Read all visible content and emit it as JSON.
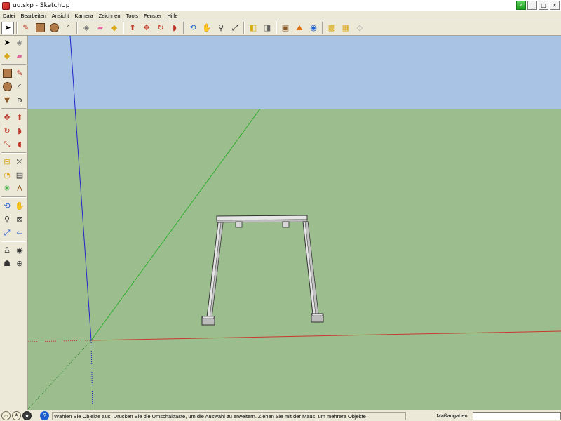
{
  "window": {
    "title": "uu.skp - SketchUp",
    "controls": [
      "_",
      "□",
      "✕"
    ]
  },
  "menu": {
    "items": [
      "Datei",
      "Bearbeiten",
      "Ansicht",
      "Kamera",
      "Zeichnen",
      "Tools",
      "Fenster",
      "Hilfe"
    ]
  },
  "top_toolbar": {
    "icons": [
      "select-icon",
      "pencil-icon",
      "rectangle-icon",
      "circle-icon",
      "arc-icon",
      "make-component-icon",
      "eraser-icon",
      "paint-bucket-icon",
      "push-pull-icon",
      "move-icon",
      "rotate-icon",
      "follow-me-icon",
      "orbit-icon",
      "pan-icon",
      "zoom-icon",
      "zoom-extents-icon",
      "previous-view-icon",
      "next-view-icon",
      "add-location-icon",
      "google-earth-icon",
      "3d-warehouse-icon",
      "share-model-icon",
      "get-models-icon"
    ]
  },
  "left_toolbar": {
    "icons": [
      "select-icon",
      "make-component-icon",
      "paint-bucket-icon",
      "eraser-icon",
      "rectangle-icon",
      "line-icon",
      "circle-icon",
      "arc-icon",
      "polygon-icon",
      "freehand-icon",
      "move-icon",
      "push-pull-icon",
      "rotate-icon",
      "follow-me-icon",
      "scale-icon",
      "offset-icon",
      "tape-measure-icon",
      "dimension-icon",
      "protractor-icon",
      "text-icon",
      "axes-icon",
      "3d-text-icon",
      "orbit-icon",
      "pan-icon",
      "zoom-icon",
      "zoom-window-icon",
      "zoom-extents-icon",
      "previous-view-icon",
      "position-camera-icon",
      "look-around-icon",
      "walk-icon",
      "section-plane-icon"
    ]
  },
  "viewport": {
    "sky_color": "#a9c3e5",
    "ground_color": "#9cbd8e",
    "axis_red": "#c8392b",
    "axis_green": "#2fae2f",
    "axis_blue": "#2424c8"
  },
  "status": {
    "message": "Wählen Sie Objekte aus. Drücken Sie die Umschalttaste, um die Auswahl zu erweitern. Ziehen Sie mit der Maus, um mehrere Objekte",
    "measure_label": "Maßangaben",
    "measure_value": ""
  }
}
